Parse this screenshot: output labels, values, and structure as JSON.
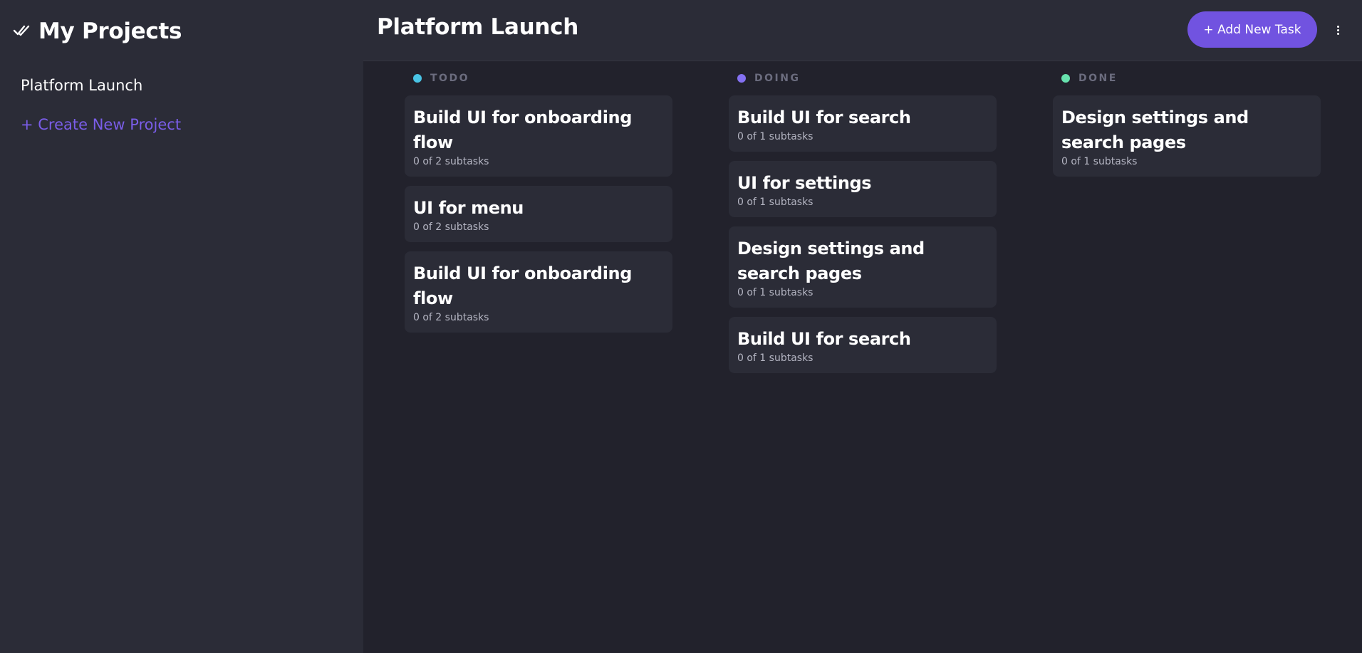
{
  "sidebar": {
    "brand_title": "My Projects",
    "brand_icon": "double-check-icon",
    "projects": [
      "Platform Launch"
    ],
    "create_label": "+ Create New Project"
  },
  "header": {
    "title": "Platform Launch",
    "add_task_label": "+ Add New Task",
    "menu_icon": "vertical-ellipsis-icon"
  },
  "colors": {
    "accent": "#7153e0",
    "todo": "#49c4e5",
    "doing": "#8471f2",
    "done": "#67e2ae"
  },
  "columns": [
    {
      "name": "TODO",
      "cards": [
        {
          "title": "Build UI for onboarding flow",
          "subtasks": "0 of 2 subtasks"
        },
        {
          "title": "UI for menu",
          "subtasks": "0 of 2 subtasks"
        },
        {
          "title": "Build UI for onboarding flow",
          "subtasks": "0 of 2 subtasks"
        }
      ]
    },
    {
      "name": "DOING",
      "cards": [
        {
          "title": "Build UI for search",
          "subtasks": "0 of 1 subtasks"
        },
        {
          "title": "UI for settings",
          "subtasks": "0 of 1 subtasks"
        },
        {
          "title": "Design settings and search pages",
          "subtasks": "0 of 1 subtasks"
        },
        {
          "title": "Build UI for search",
          "subtasks": "0 of 1 subtasks"
        }
      ]
    },
    {
      "name": "DONE",
      "cards": [
        {
          "title": "Design settings and search pages",
          "subtasks": "0 of 1 subtasks"
        }
      ]
    }
  ]
}
